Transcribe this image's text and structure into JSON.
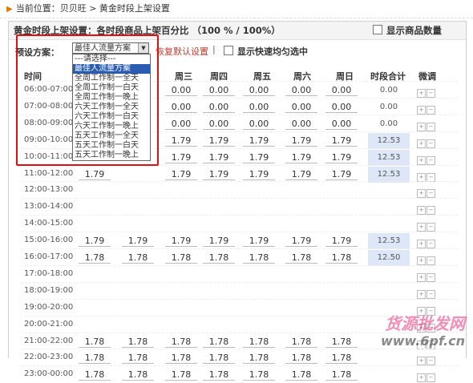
{
  "breadcrumb": {
    "prefix": "当前位置：",
    "site": "贝贝旺",
    "sep": ">",
    "page": "黄金时段上架设置"
  },
  "header": {
    "title": "黄金时段上架设置：各时段商品上架百分比 （100 % / 100%）",
    "show_count": "显示商品数量"
  },
  "plan": {
    "label": "预设方案：",
    "selected": "最佳人流量方案",
    "restore": "恢复默认设置",
    "sep": "|",
    "quick": "显示快速均匀选中"
  },
  "dropdown_options": [
    "---请选择---",
    "最佳人流量方案",
    "全周工作制一全天",
    "全周工作制一白天",
    "全周工作制一晚上",
    "六天工作制一全天",
    "六天工作制一白天",
    "六天工作制一晚上",
    "五天工作制一全天",
    "五天工作制一白天",
    "五天工作制一晚上"
  ],
  "dropdown_highlight": 1,
  "columns": [
    "时间",
    "周三",
    "周四",
    "周五",
    "周六",
    "周日",
    "时段合计",
    "微调"
  ],
  "adjust_icons": [
    "plus-icon",
    "minus-icon"
  ],
  "rows": [
    {
      "time": "06:00-07:00",
      "vals": [
        "0.00",
        "0.00",
        "0.00",
        "0.00",
        "0.00"
      ],
      "total": "0.00",
      "hl": false
    },
    {
      "time": "07:00-08:00",
      "vals": [
        "0.00",
        "0.00",
        "0.00",
        "0.00",
        "0.00"
      ],
      "total": "0.00",
      "hl": false
    },
    {
      "time": "08:00-09:00",
      "vals": [
        "0.00",
        "0.00",
        "0.00",
        "0.00",
        "0.00"
      ],
      "total": "0.00",
      "hl": false
    },
    {
      "time": "09:00-10:00",
      "vals": [
        "1.79",
        "1.79",
        "1.79",
        "1.79",
        "1.79"
      ],
      "total": "12.53",
      "hl": true
    },
    {
      "time": "10:00-11:00",
      "vals": [
        "1.79",
        "1.79",
        "1.79",
        "1.79",
        "1.79"
      ],
      "total": "12.53",
      "hl": true
    },
    {
      "time": "11:00-12:00",
      "vals": [
        "1.79",
        "1.79",
        "1.79",
        "1.79",
        "1.79"
      ],
      "total": "12.53",
      "hl": true,
      "extra": "1.79"
    },
    {
      "time": "12:00-13:00",
      "vals": [],
      "total": "",
      "hl": false
    },
    {
      "time": "13:00-14:00",
      "vals": [],
      "total": "",
      "hl": false
    },
    {
      "time": "14:00-15:00",
      "vals": [],
      "total": "",
      "hl": false
    },
    {
      "time": "15:00-16:00",
      "vals": [
        "1.79",
        "1.79",
        "1.79",
        "1.79",
        "1.79"
      ],
      "total": "12.53",
      "hl": true,
      "extra": "1.79",
      "extra2": "1.79"
    },
    {
      "time": "16:00-17:00",
      "vals": [
        "1.78",
        "1.78",
        "1.78",
        "1.78",
        "1.78"
      ],
      "total": "12.50",
      "hl": true,
      "extra": "1.78",
      "extra2": "1.78"
    },
    {
      "time": "17:00-18:00",
      "vals": [],
      "total": "",
      "hl": false
    },
    {
      "time": "18:00-19:00",
      "vals": [],
      "total": "",
      "hl": false
    },
    {
      "time": "19:00-20:00",
      "vals": [],
      "total": "",
      "hl": false
    },
    {
      "time": "20:00-21:00",
      "vals": [],
      "total": "",
      "hl": false
    },
    {
      "time": "21:00-22:00",
      "vals": [
        "1.78",
        "1.78",
        "1.78",
        "1.78",
        "1.78"
      ],
      "total": "",
      "hl": false,
      "extra": "1.78",
      "extra2": "1.78"
    },
    {
      "time": "22:00-23:00",
      "vals": [
        "1.78",
        "1.78",
        "1.78",
        "1.78",
        "1.78"
      ],
      "total": "",
      "hl": false,
      "extra": "1.78",
      "extra2": "1.78"
    },
    {
      "time": "23:00-00:00",
      "vals": [
        "1.78",
        "1.78",
        "1.78",
        "1.78",
        "1.78"
      ],
      "total": "",
      "hl": false,
      "extra": "1.78",
      "extra2": "1.78"
    }
  ],
  "watermark": {
    "line1": "货源批发网",
    "line2": "www.6pf.cn",
    "color1": "#e8317a",
    "color2": "#2a2a2a"
  },
  "colors": {
    "highlight_border": "#e01010",
    "total_highlight": "#dde7f7",
    "link_red": "#c0392b",
    "crumb_arrow": "#e07b00"
  }
}
